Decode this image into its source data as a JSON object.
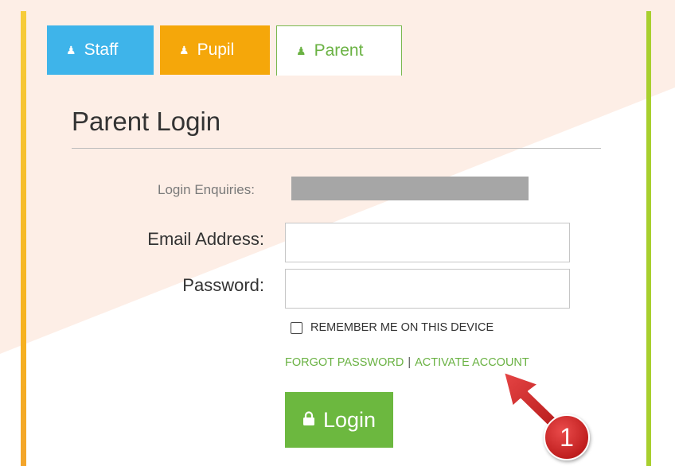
{
  "tabs": [
    {
      "label": "Staff",
      "icon": "user-icon",
      "color": "#3eb4ea"
    },
    {
      "label": "Pupil",
      "icon": "user-icon",
      "color": "#f5a70a"
    },
    {
      "label": "Parent",
      "icon": "user-icon",
      "color": "#6ab243",
      "active": true
    }
  ],
  "form": {
    "title": "Parent Login",
    "enquiries_label": "Login Enquiries:",
    "email_label": "Email Address:",
    "email_value": "",
    "password_label": "Password:",
    "password_value": "",
    "remember_label": "REMEMBER ME ON THIS DEVICE",
    "remember_checked": false,
    "forgot_password": "FORGOT PASSWORD",
    "separator": "|",
    "activate_account": "ACTIVATE ACCOUNT",
    "login_button": "Login"
  },
  "annotation": {
    "badge": "1",
    "color": "#d32a2a"
  },
  "colors": {
    "accent_green": "#6cb83f",
    "staff_blue": "#3eb4ea",
    "pupil_orange": "#f5a70a"
  }
}
